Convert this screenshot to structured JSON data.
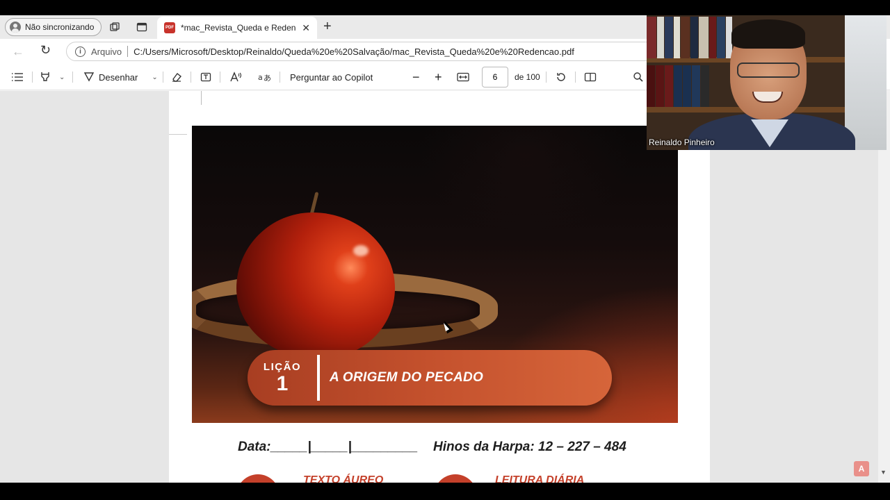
{
  "browser": {
    "profile_label": "Não sincronizando",
    "tab_title": "*mac_Revista_Queda e Redencao.pdf",
    "tab_badge": "PDF",
    "address_prefix": "Arquivo",
    "address_url": "C:/Users/Microsoft/Desktop/Reinaldo/Queda%20e%20Salvação/mac_Revista_Queda%20e%20Redencao.pdf"
  },
  "pdf_toolbar": {
    "draw_label": "Desenhar",
    "copilot_label": "Perguntar ao Copilot",
    "zoom_out": "−",
    "zoom_in": "+",
    "current_page": "6",
    "page_total": "de 100"
  },
  "document": {
    "lesson_word": "LIÇÃO",
    "lesson_number": "1",
    "lesson_title": "A ORIGEM DO PECADO",
    "date_label": "Data:_____|_____|_________",
    "hymns_label": "Hinos da Harpa: 12 – 227 – 484",
    "section_golden_text": "TEXTO ÁUREO",
    "section_daily_reading": "LEITURA DIÁRIA"
  },
  "webcam": {
    "participant_name": "Reinaldo Pinheiro"
  },
  "colors": {
    "accent_red": "#c4402a",
    "pdf_badge": "#c8332b"
  }
}
